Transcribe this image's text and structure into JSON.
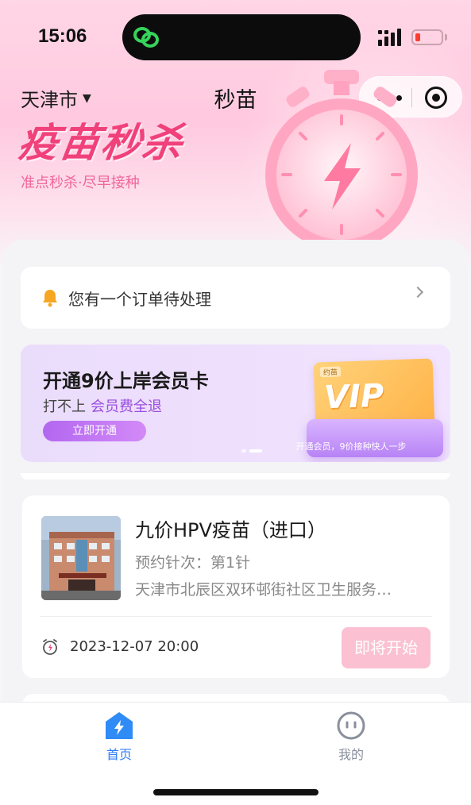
{
  "status_bar": {
    "time": "15:06"
  },
  "nav": {
    "city": "天津市",
    "title": "秒苗"
  },
  "banner": {
    "title": "疫苗秒杀",
    "subtitle": "准点秒杀·尽早接种"
  },
  "notice": {
    "text": "您有一个订单待处理"
  },
  "vip_promo": {
    "title": "开通9价上岸会员卡",
    "sub_prefix": "打不上",
    "sub_highlight": "会员费全退",
    "button": "立即开通",
    "ticket_tag": "约苗",
    "ticket_word": "VIP",
    "tray_text": "开通会员，9价接种快人一步"
  },
  "vaccine": {
    "name": "九价HPV疫苗（进口）",
    "dose": "预约针次：第1针",
    "address": "天津市北辰区双环邨街社区卫生服务中心",
    "time": "2023-12-07 20:00",
    "button": "即将开始"
  },
  "tabbar": {
    "home": "首页",
    "mine": "我的",
    "active_color": "#2f7cf6",
    "inactive_color": "#8a8f9c"
  },
  "colors": {
    "brand_pink": "#f0417b",
    "vip_purple": "#9a4dde"
  }
}
